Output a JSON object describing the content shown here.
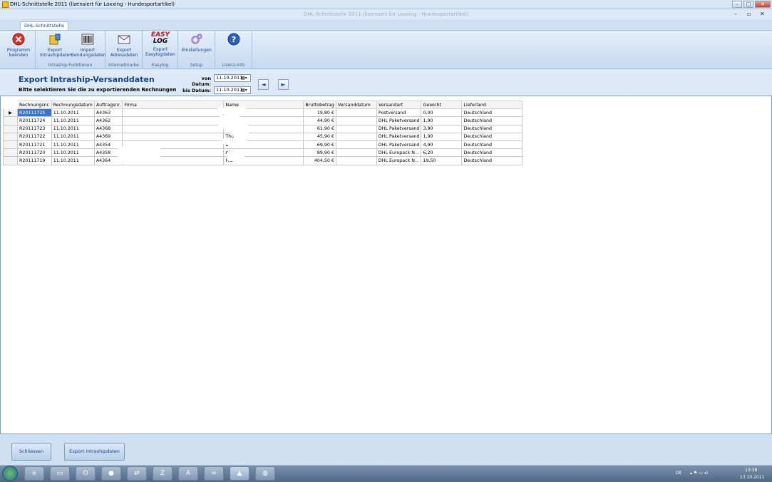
{
  "window": {
    "title": "DHL-Schnittstelle 2011 (lizensiert für Loxxing - Hundesportartikel)",
    "subtitle": "DHL-Schnittstelle 2011 (lizensiert für Loxxing - Hundesportartikel)",
    "min": "–",
    "max": "□",
    "close": "✕",
    "inner_min": "–",
    "inner_restore": "▫",
    "inner_close": "✕"
  },
  "ribbon": {
    "tab": "DHL-Schnittstelle",
    "groups": [
      {
        "label": ""
      },
      {
        "label": "Intraship-Funktionen"
      },
      {
        "label": "Internetmarke"
      },
      {
        "label": "Easylog"
      },
      {
        "label": "Setup"
      },
      {
        "label": "Lizenz-Info"
      }
    ],
    "buttons": {
      "quit": "Programm beenden",
      "export_intraship": "Export Intrashipdaten",
      "import_shipments": "Import Sendungsdaten",
      "export_addresses": "Export Adressdaten",
      "export_easylog": "Export Easylogdaten",
      "settings": "Einstellungen"
    },
    "easylog_logo": [
      "EASY",
      "LOG"
    ]
  },
  "page": {
    "title": "Export Intraship-Versanddaten",
    "instruction": "Bitte selektieren Sie die zu exportierenden Rechnungen",
    "from_label": "von Datum:",
    "from_value": "11.10.2011",
    "to_label": "bis Datum:",
    "to_value": "11.10.2011",
    "dropdown_glyph": "▦▾",
    "prev": "◄",
    "next": "►"
  },
  "table": {
    "columns": [
      "Rechnungsnr.",
      "Rechnungsdatum",
      "Auftragsnr.",
      "Firma",
      "Name",
      "Bruttobetrag",
      "Versanddatum",
      "Versandart",
      "Gewicht",
      "Lieferland"
    ],
    "current_row_marker": "▶",
    "rows": [
      [
        "R20111725",
        "11.10.2011",
        "A4363",
        "",
        "",
        "19,80 €",
        "",
        "Postversand",
        "0,00",
        "Deutschland"
      ],
      [
        "R20111724",
        "11.10.2011",
        "A4362",
        "",
        "",
        "44,90 €",
        "",
        "DHL Paketversand",
        "1,90",
        "Deutschland"
      ],
      [
        "R20111723",
        "11.10.2011",
        "A4368",
        "",
        "",
        "61,90 €",
        "",
        "DHL Paketversand",
        "3,90",
        "Deutschland"
      ],
      [
        "R20111722",
        "11.10.2011",
        "A4369",
        "",
        "Tho",
        "45,90 €",
        "",
        "DHL Paketversand",
        "1,90",
        "Deutschland"
      ],
      [
        "R20111721",
        "11.10.2011",
        "A4354",
        "",
        "B",
        "69,90 €",
        "",
        "DHL Paketversand",
        "4,90",
        "Deutschland"
      ],
      [
        "R20111720",
        "11.10.2011",
        "A4358",
        "",
        "Al",
        "89,90 €",
        "",
        "DHL Europack N...",
        "6,20",
        "Deutschland"
      ],
      [
        "R20111719",
        "11.10.2011",
        "A4364",
        "",
        "Fra",
        "404,50 €",
        "",
        "DHL Europack N...",
        "19,50",
        "Deutschland"
      ]
    ]
  },
  "footer": {
    "close": "Schliessen",
    "export": "Export Intrashipdaten"
  },
  "taskbar": {
    "lang": "DE",
    "time": "13:38",
    "date": "13.10.2011"
  }
}
